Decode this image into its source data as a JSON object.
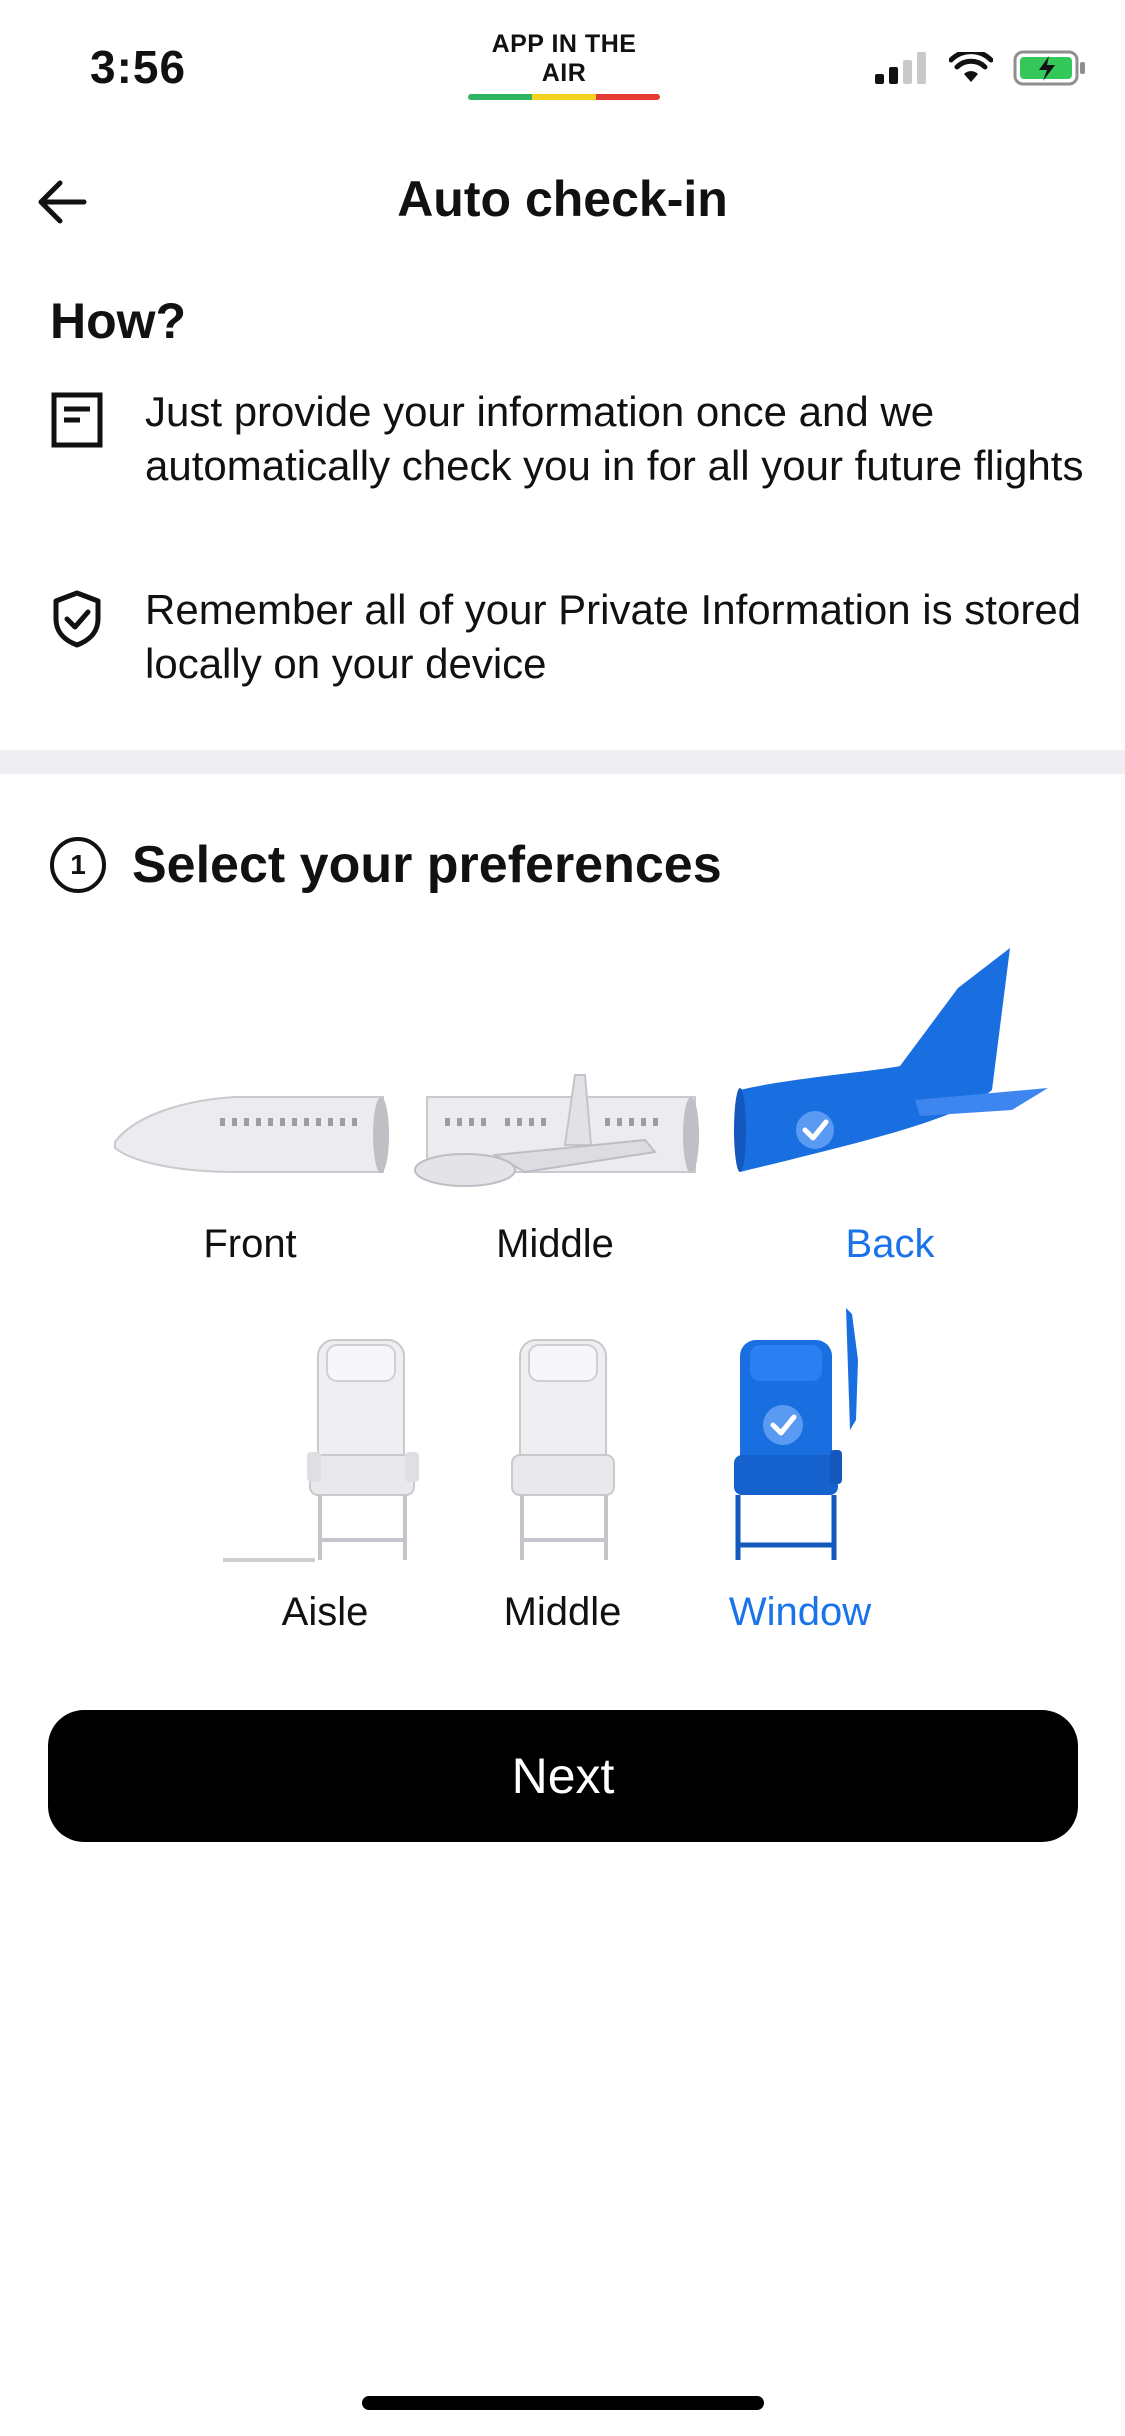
{
  "status_bar": {
    "time": "3:56",
    "brand": "APP IN THE AIR",
    "brand_colors": [
      "#2fb463",
      "#f2d41e",
      "#e53935"
    ],
    "icons": [
      "signal-icon",
      "wifi-icon",
      "battery-charging-icon"
    ]
  },
  "nav": {
    "back_icon": "arrow-left-icon",
    "title": "Auto check-in"
  },
  "how": {
    "title": "How?",
    "items": [
      {
        "icon": "document-icon",
        "text": "Just provide your information once and we automatically check you in for all your future flights"
      },
      {
        "icon": "shield-check-icon",
        "text": "Remember all of your Private Information is stored locally on your device"
      }
    ]
  },
  "preferences": {
    "step": "1",
    "title": "Select your preferences",
    "cabin_section": [
      {
        "label": "Front",
        "selected": false
      },
      {
        "label": "Middle",
        "selected": false
      },
      {
        "label": "Back",
        "selected": true
      }
    ],
    "seat_position": [
      {
        "label": "Aisle",
        "selected": false
      },
      {
        "label": "Middle",
        "selected": false
      },
      {
        "label": "Window",
        "selected": true
      }
    ]
  },
  "next_button": "Next",
  "colors": {
    "accent": "#1a73e8",
    "selected_fill": "#1a6fe0",
    "unselected_fill": "#e9e9ec",
    "divider": "#eeeef3"
  }
}
